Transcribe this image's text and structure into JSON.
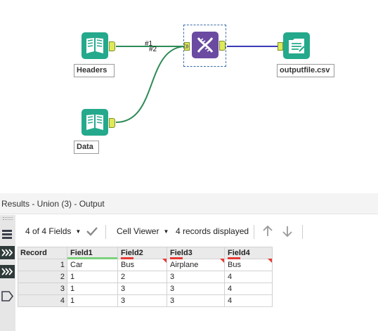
{
  "workflow": {
    "tools": {
      "headers": {
        "label": "Headers",
        "icon": "input-data-book-icon"
      },
      "data": {
        "label": "Data",
        "icon": "input-data-book-icon"
      },
      "union": {
        "icon": "union-dna-icon"
      },
      "output": {
        "label": "outputfile.csv",
        "icon": "output-data-icon"
      }
    },
    "connections": {
      "label_1": "#1",
      "label_2": "#2"
    },
    "colors": {
      "input_tool": "#24a98c",
      "union_tool": "#6a4ba1",
      "wire_green": "#2e8b57",
      "wire_blue": "#3a3ab8",
      "anchor": "#dfe95a"
    }
  },
  "results": {
    "title": "Results - Union (3) - Output",
    "toolbar": {
      "fields_selector": "4 of 4 Fields",
      "view_selector": "Cell Viewer",
      "records_count": "4 records displayed"
    },
    "sidebar_icons": [
      "fields-list-icon",
      "forward-chevrons-icon",
      "forward-chevrons-icon",
      "tag-outline-icon"
    ],
    "table": {
      "columns": [
        "Record",
        "Field1",
        "Field2",
        "Field3",
        "Field4"
      ],
      "rows": [
        [
          "1",
          "Car",
          "Bus",
          "Airplane",
          "Bus"
        ],
        [
          "2",
          "1",
          "2",
          "3",
          "4"
        ],
        [
          "3",
          "1",
          "3",
          "3",
          "4"
        ],
        [
          "4",
          "1",
          "3",
          "3",
          "4"
        ]
      ]
    }
  }
}
